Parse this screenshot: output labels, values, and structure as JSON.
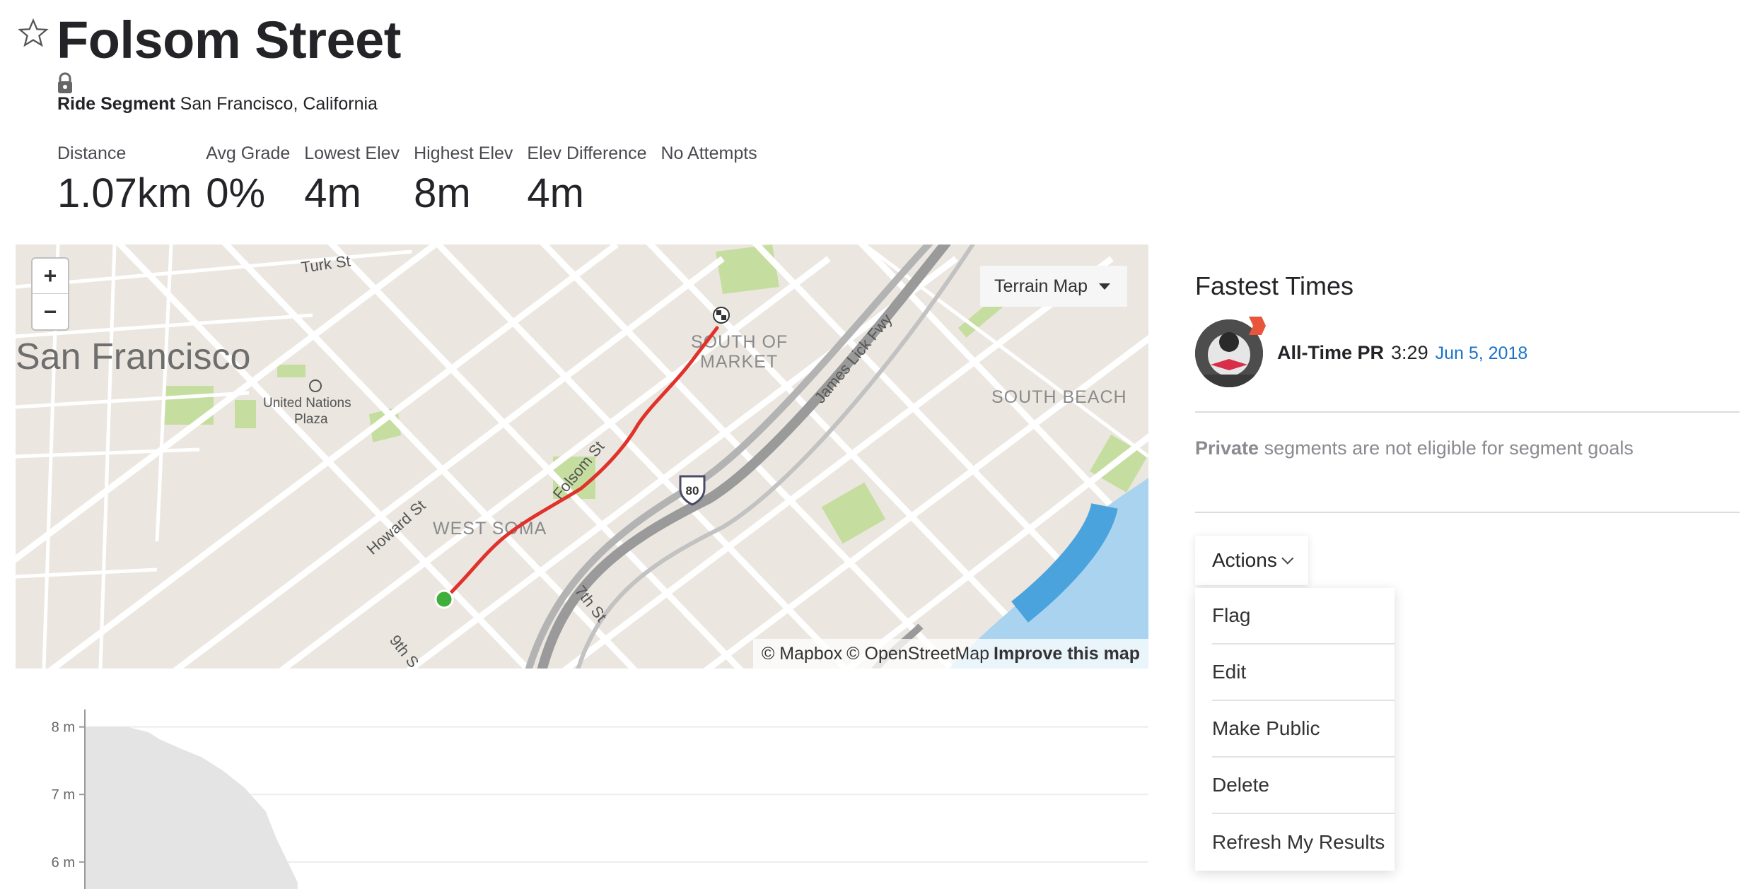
{
  "header": {
    "title": "Folsom Street",
    "segment_type": "Ride Segment",
    "location": "San Francisco, California"
  },
  "stats": [
    {
      "label": "Distance",
      "value": "1.07km"
    },
    {
      "label": "Avg Grade",
      "value": "0%"
    },
    {
      "label": "Lowest Elev",
      "value": "4m"
    },
    {
      "label": "Highest Elev",
      "value": "8m"
    },
    {
      "label": "Elev Difference",
      "value": "4m"
    },
    {
      "label": "No Attempts",
      "value": ""
    }
  ],
  "map": {
    "zoom_in": "+",
    "zoom_out": "−",
    "style_button": "Terrain Map",
    "attribution_mapbox": "© Mapbox",
    "attribution_osm": "© OpenStreetMap",
    "improve_link": "Improve this map",
    "labels": {
      "city": "San Francisco",
      "un_plaza_1": "United Nations",
      "un_plaza_2": "Plaza",
      "turk": "Turk St",
      "soma_1": "SOUTH OF",
      "soma_2": "MARKET",
      "south_beach": "SOUTH BEACH",
      "james_lick": "James Lick Fwy",
      "folsom": "Folsom St",
      "howard": "Howard St",
      "west_soma": "WEST SOMA",
      "seventh": "7th St",
      "ninth": "9th S",
      "shield": "80"
    },
    "route_color": "#e0312b",
    "start_color": "#3fae3a"
  },
  "elevation_chart": {
    "y_ticks": [
      "8 m",
      "7 m",
      "6 m"
    ]
  },
  "sidebar": {
    "fastest_times_title": "Fastest Times",
    "pr_label": "All-Time PR",
    "pr_time": "3:29",
    "pr_date": "Jun 5, 2018",
    "private_bold": "Private",
    "private_rest": " segments are not eligible for segment goals",
    "actions_label": "Actions",
    "menu": [
      "Flag",
      "Edit",
      "Make Public",
      "Delete",
      "Refresh My Results"
    ]
  },
  "chart_data": {
    "type": "area",
    "title": "",
    "xlabel": "",
    "ylabel": "",
    "ylim": [
      5.6,
      8.3
    ],
    "y_ticks": [
      8,
      7,
      6
    ],
    "series": [
      {
        "x": [
          0,
          0.04,
          0.06,
          0.07,
          0.09,
          0.11,
          0.13,
          0.15,
          0.17,
          0.18,
          0.2
        ],
        "values": [
          8,
          8,
          7.92,
          7.82,
          7.68,
          7.55,
          7.35,
          7.1,
          6.75,
          6.35,
          5.7
        ]
      }
    ]
  }
}
